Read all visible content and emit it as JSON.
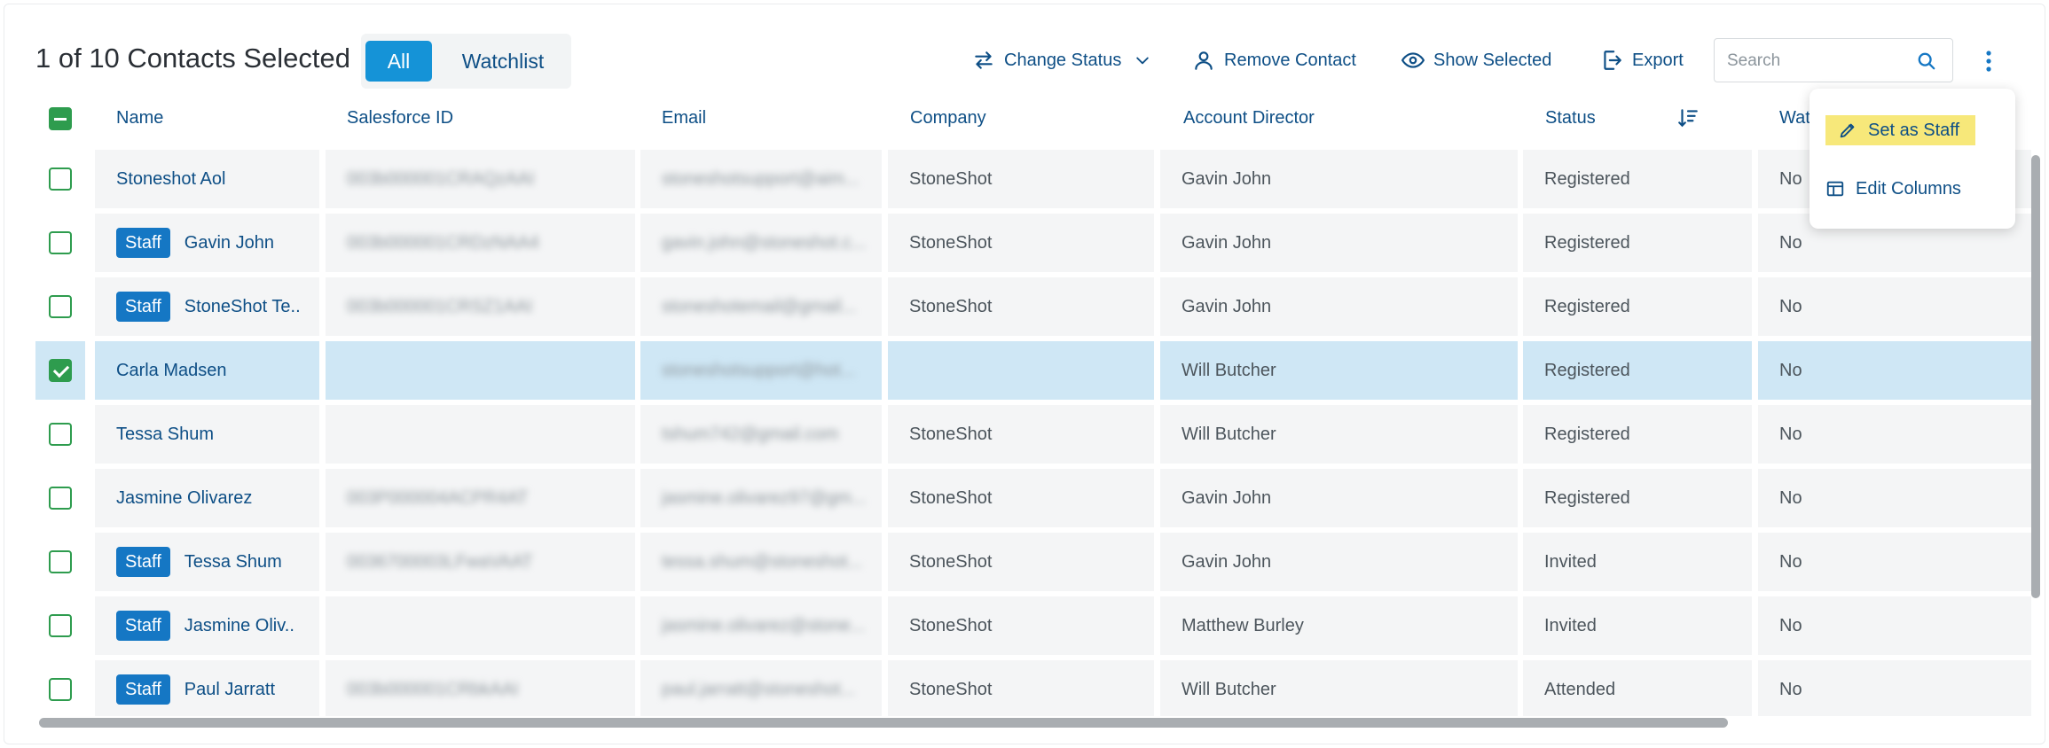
{
  "header": {
    "selection_summary": "1 of 10 Contacts Selected",
    "tabs": [
      {
        "label": "All",
        "active": true
      },
      {
        "label": "Watchlist",
        "active": false
      }
    ],
    "actions": {
      "change_status": "Change Status",
      "remove_contact": "Remove Contact",
      "show_selected": "Show Selected",
      "export": "Export"
    },
    "search_placeholder": "Search"
  },
  "columns": {
    "name": "Name",
    "salesforce_id": "Salesforce ID",
    "email": "Email",
    "company": "Company",
    "account_director": "Account Director",
    "status": "Status",
    "watchlist": "Wat"
  },
  "staff_badge": "Staff",
  "rows": [
    {
      "name": "Stoneshot Aol",
      "staff": false,
      "salesforce_id": "003b000001CRAQzAAI",
      "email": "stoneshotsupport@aim...",
      "company": "StoneShot",
      "account_director": "Gavin John",
      "status": "Registered",
      "watchlist": "No",
      "checked": false
    },
    {
      "name": "Gavin John",
      "staff": true,
      "salesforce_id": "003b000001CRDzNAA4",
      "email": "gavin.john@stoneshot.c...",
      "company": "StoneShot",
      "account_director": "Gavin John",
      "status": "Registered",
      "watchlist": "No",
      "checked": false
    },
    {
      "name": "StoneShot Te..",
      "staff": true,
      "salesforce_id": "003b000001CRSZ1AAI",
      "email": "stoneshotemail@gmail...",
      "company": "StoneShot",
      "account_director": "Gavin John",
      "status": "Registered",
      "watchlist": "No",
      "checked": false
    },
    {
      "name": "Carla Madsen",
      "staff": false,
      "salesforce_id": "",
      "email": "stoneshotsupport@hot...",
      "company": "",
      "account_director": "Will Butcher",
      "status": "Registered",
      "watchlist": "No",
      "checked": true
    },
    {
      "name": "Tessa Shum",
      "staff": false,
      "salesforce_id": "",
      "email": "tshum742@gmail.com",
      "company": "StoneShot",
      "account_director": "Will Butcher",
      "status": "Registered",
      "watchlist": "No",
      "checked": false
    },
    {
      "name": "Jasmine Olivarez",
      "staff": false,
      "salesforce_id": "003P000004ACPR4AT",
      "email": "jasmine.olivarez97@gm...",
      "company": "StoneShot",
      "account_director": "Gavin John",
      "status": "Registered",
      "watchlist": "No",
      "checked": false
    },
    {
      "name": "Tessa Shum",
      "staff": true,
      "salesforce_id": "0036700003LFwaVAAT",
      "email": "tessa.shum@stoneshot...",
      "company": "StoneShot",
      "account_director": "Gavin John",
      "status": "Invited",
      "watchlist": "No",
      "checked": false
    },
    {
      "name": "Jasmine Oliv..",
      "staff": true,
      "salesforce_id": "",
      "email": "jasmine.olivarez@stone...",
      "company": "StoneShot",
      "account_director": "Matthew Burley",
      "status": "Invited",
      "watchlist": "No",
      "checked": false
    },
    {
      "name": "Paul Jarratt",
      "staff": true,
      "salesforce_id": "003b000001CRbkAAI",
      "email": "paul.jarratt@stoneshot...",
      "company": "StoneShot",
      "account_director": "Will Butcher",
      "status": "Attended",
      "watchlist": "No",
      "checked": false
    }
  ],
  "menu": {
    "set_as_staff": "Set as Staff",
    "edit_columns": "Edit Columns"
  }
}
